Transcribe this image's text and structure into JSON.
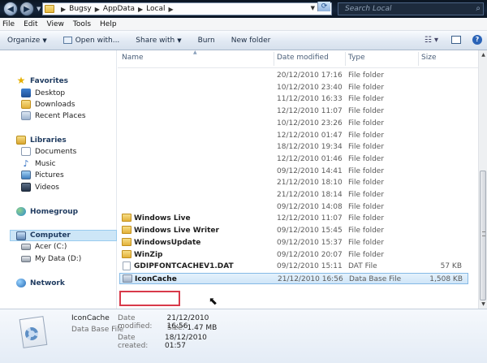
{
  "address": {
    "breadcrumbs": [
      "Bugsy",
      "AppData",
      "Local"
    ],
    "search_placeholder": "Search Local"
  },
  "menu": [
    "File",
    "Edit",
    "View",
    "Tools",
    "Help"
  ],
  "toolbar": {
    "organize": "Organize",
    "open_with": "Open with...",
    "share_with": "Share with",
    "burn": "Burn",
    "new_folder": "New folder"
  },
  "nav": {
    "favorites": "Favorites",
    "desktop": "Desktop",
    "downloads": "Downloads",
    "recent_places": "Recent Places",
    "libraries": "Libraries",
    "documents": "Documents",
    "music": "Music",
    "pictures": "Pictures",
    "videos": "Videos",
    "homegroup": "Homegroup",
    "computer": "Computer",
    "acer": "Acer (C:)",
    "mydata": "My Data (D:)",
    "network": "Network"
  },
  "columns": {
    "name": "Name",
    "date_modified": "Date modified",
    "type": "Type",
    "size": "Size"
  },
  "rows": [
    {
      "name": "",
      "date": "20/12/2010 17:16",
      "type": "File folder",
      "size": ""
    },
    {
      "name": "",
      "date": "10/12/2010 23:40",
      "type": "File folder",
      "size": ""
    },
    {
      "name": "",
      "date": "11/12/2010 16:33",
      "type": "File folder",
      "size": ""
    },
    {
      "name": "",
      "date": "12/12/2010 11:07",
      "type": "File folder",
      "size": ""
    },
    {
      "name": "",
      "date": "10/12/2010 23:26",
      "type": "File folder",
      "size": ""
    },
    {
      "name": "",
      "date": "12/12/2010 01:47",
      "type": "File folder",
      "size": ""
    },
    {
      "name": "",
      "date": "18/12/2010 19:34",
      "type": "File folder",
      "size": ""
    },
    {
      "name": "",
      "date": "12/12/2010 01:46",
      "type": "File folder",
      "size": ""
    },
    {
      "name": "",
      "date": "09/12/2010 14:41",
      "type": "File folder",
      "size": ""
    },
    {
      "name": "",
      "date": "21/12/2010 18:10",
      "type": "File folder",
      "size": ""
    },
    {
      "name": "",
      "date": "21/12/2010 18:14",
      "type": "File folder",
      "size": ""
    },
    {
      "name": "",
      "date": "09/12/2010 14:08",
      "type": "File folder",
      "size": ""
    },
    {
      "name": "Windows Live",
      "date": "12/12/2010 11:07",
      "type": "File folder",
      "size": ""
    },
    {
      "name": "Windows Live Writer",
      "date": "09/12/2010 15:45",
      "type": "File folder",
      "size": ""
    },
    {
      "name": "WindowsUpdate",
      "date": "09/12/2010 15:37",
      "type": "File folder",
      "size": ""
    },
    {
      "name": "WinZip",
      "date": "09/12/2010 20:07",
      "type": "File folder",
      "size": ""
    },
    {
      "name": "GDIPFONTCACHEV1.DAT",
      "date": "09/12/2010 15:11",
      "type": "DAT File",
      "size": "57 KB"
    },
    {
      "name": "IconCache",
      "date": "21/12/2010 16:56",
      "type": "Data Base File",
      "size": "1,508 KB"
    }
  ],
  "details": {
    "name": "IconCache",
    "type": "Data Base File",
    "date_modified_label": "Date modified:",
    "date_modified": "21/12/2010 16:56",
    "size_label": "Size:",
    "size": "1.47 MB",
    "date_created_label": "Date created:",
    "date_created": "18/12/2010 01:57"
  }
}
